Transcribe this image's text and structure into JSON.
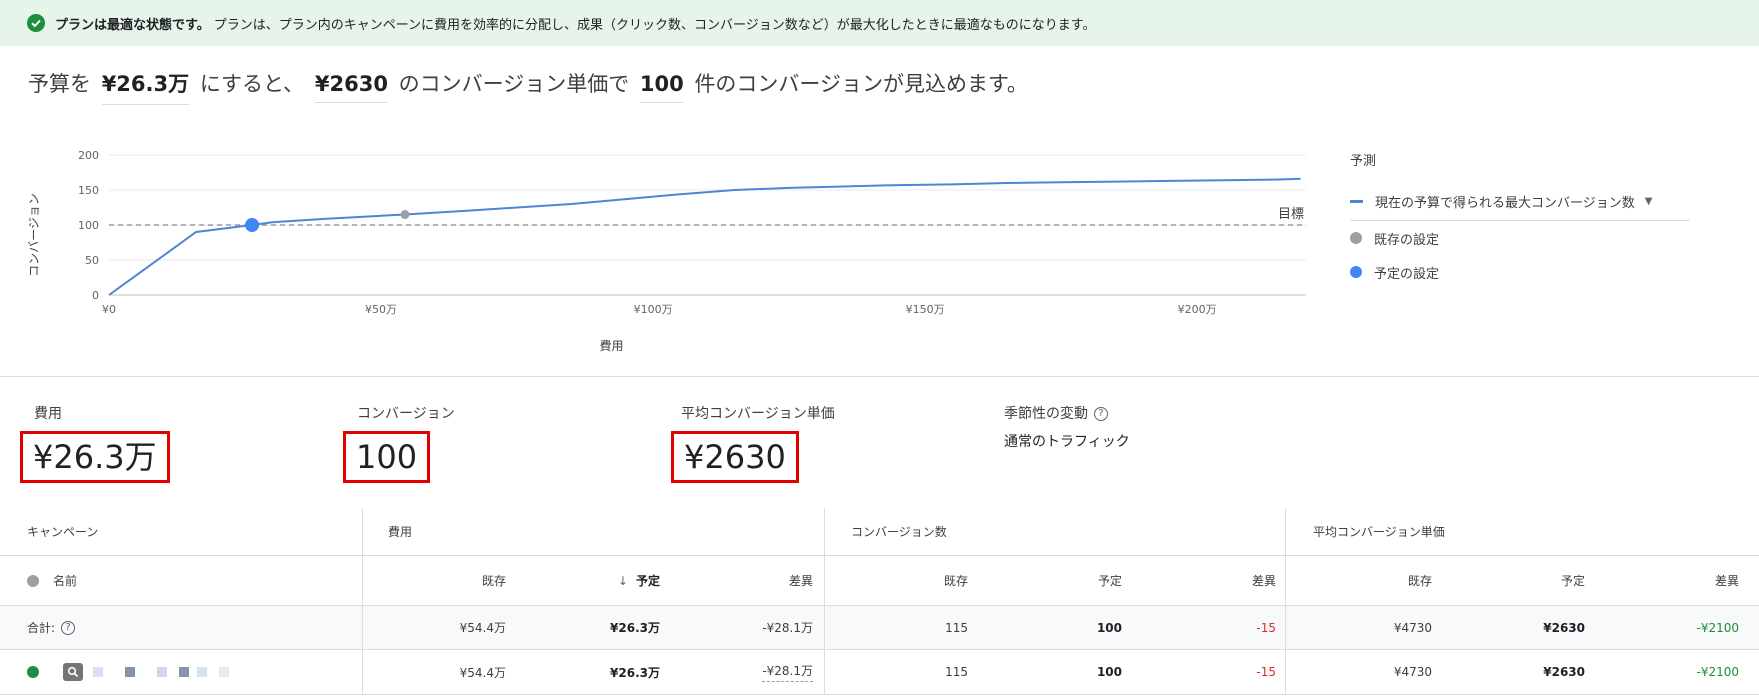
{
  "banner": {
    "strong": "プランは最適な状態です。",
    "text": "プランは、プラン内のキャンペーンに費用を効率的に分配し、成果（クリック数、コンバージョン数など）が最大化したときに最適なものになります。"
  },
  "summary": {
    "p1": "予算を",
    "budget": "¥26.3万",
    "p2": "にすると、",
    "cpa": "¥2630",
    "p3": "のコンバージョン単価で",
    "conversions": "100",
    "p4": "件のコンバージョンが見込めます。"
  },
  "chart_data": {
    "type": "line",
    "xlabel": "費用",
    "ylabel": "コンバージョン",
    "xlim": [
      0,
      220
    ],
    "ylim": [
      0,
      200
    ],
    "x_ticks": [
      "¥0",
      "¥50万",
      "¥100万",
      "¥150万",
      "¥200万"
    ],
    "x_tick_values": [
      0,
      50,
      100,
      150,
      200
    ],
    "y_ticks": [
      "0",
      "50",
      "100",
      "150",
      "200"
    ],
    "y_tick_values": [
      0,
      50,
      100,
      150,
      200
    ],
    "series": [
      {
        "name": "現在の予算で得られる最大コンバージョン数",
        "color": "#4e86d4",
        "x": [
          0,
          16,
          26.3,
          30,
          40,
          54.4,
          65,
          75,
          85,
          95,
          105,
          115,
          125,
          135,
          145,
          155,
          165,
          175,
          185,
          195,
          205,
          215,
          219
        ],
        "y": [
          0,
          90,
          100,
          104,
          109,
          115,
          120,
          125,
          130,
          137,
          144,
          150,
          153,
          155,
          157,
          158,
          160,
          161,
          162,
          163,
          164,
          165,
          166
        ]
      }
    ],
    "target": {
      "label": "目標",
      "value": 100
    },
    "points": [
      {
        "name": "既存の設定",
        "x": 54.4,
        "y": 115,
        "color": "#9aa0a6"
      },
      {
        "name": "予定の設定",
        "x": 26.3,
        "y": 100,
        "color": "#4285f4"
      }
    ],
    "grid": true
  },
  "legend": {
    "title": "予測",
    "line": "現在の予算で得られる最大コンバージョン数",
    "existing": "既存の設定",
    "planned": "予定の設定"
  },
  "stats": {
    "cost_label": "費用",
    "cost_value": "¥26.3万",
    "conv_label": "コンバージョン",
    "conv_value": "100",
    "cpa_label": "平均コンバージョン単価",
    "cpa_value": "¥2630",
    "season_label": "季節性の変動",
    "season_value": "通常のトラフィック"
  },
  "table": {
    "groups": [
      "キャンペーン",
      "費用",
      "コンバージョン数",
      "平均コンバージョン単価"
    ],
    "name_header": "名前",
    "col_existing": "既存",
    "col_planned": "予定",
    "col_diff": "差異",
    "total_label": "合計:",
    "total": {
      "cost": [
        "¥54.4万",
        "¥26.3万",
        "-¥28.1万"
      ],
      "conv": [
        "115",
        "100",
        "-15"
      ],
      "cpa": [
        "¥4730",
        "¥2630",
        "-¥2100"
      ]
    },
    "campaign": {
      "cost": [
        "¥54.4万",
        "¥26.3万",
        "-¥28.1万"
      ],
      "conv": [
        "115",
        "100",
        "-15"
      ],
      "cpa": [
        "¥4730",
        "¥2630",
        "-¥2100"
      ]
    }
  }
}
